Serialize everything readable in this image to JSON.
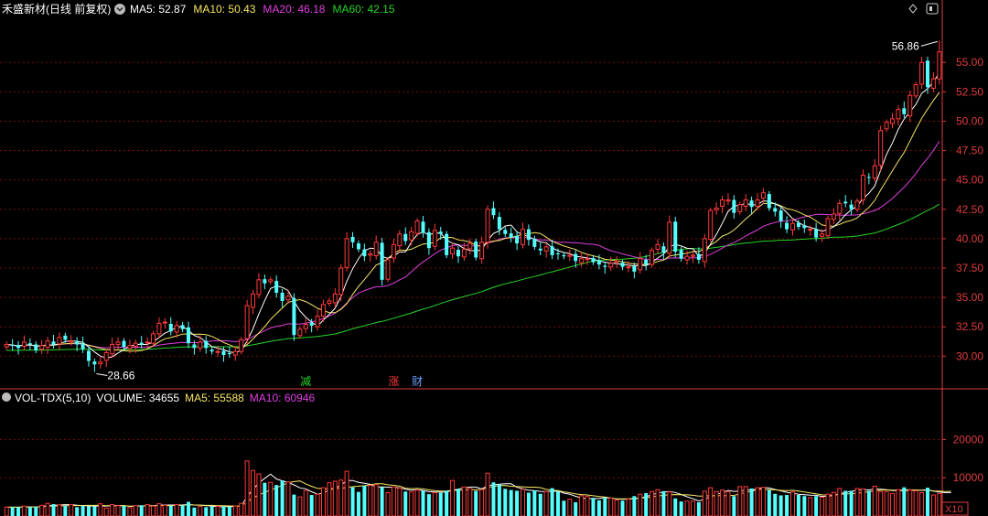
{
  "header": {
    "stock_name": "禾盛新材(日线 前复权)",
    "ma_labels": [
      {
        "text": "MA5: 52.87",
        "color": "#ffffff"
      },
      {
        "text": "MA10: 50.43",
        "color": "#f5e663"
      },
      {
        "text": "MA20: 46.18",
        "color": "#e040e0"
      },
      {
        "text": "MA60: 42.15",
        "color": "#27d427"
      }
    ]
  },
  "volume_header": {
    "labels": [
      {
        "text": "VOL-TDX(5,10)",
        "color": "#ffffff"
      },
      {
        "text": "VOLUME: 34655",
        "color": "#ffffff"
      },
      {
        "text": "MA5: 55588",
        "color": "#f5e663"
      },
      {
        "text": "MA10: 60946",
        "color": "#e040e0"
      }
    ]
  },
  "annotations": {
    "high_label": "56.86",
    "low_label": "28.66",
    "markers": [
      {
        "text": "减",
        "color": "#27d427",
        "index": 51
      },
      {
        "text": "涨",
        "color": "#ff3a3a",
        "index": 66
      },
      {
        "text": "财",
        "color": "#6aa0ff",
        "index": 70
      }
    ],
    "volume_unit": "X10"
  },
  "colors": {
    "up": "#ff3a3a",
    "down": "#54ffff",
    "grid": "#7a0e0e",
    "axis_text": "#e03c3c",
    "ma5": "#ffffff",
    "ma10": "#f5e663",
    "ma20": "#e040e0",
    "ma60": "#27d427"
  },
  "chart_data": {
    "type": "candlestick",
    "price_axis": {
      "ticks": [
        30.0,
        32.5,
        35.0,
        37.5,
        40.0,
        42.5,
        45.0,
        47.5,
        50.0,
        52.5,
        55.0
      ],
      "ylim": [
        27.3,
        58.6
      ]
    },
    "volume_axis": {
      "ticks": [
        10000,
        20000
      ],
      "ylim": [
        0,
        28000
      ]
    },
    "close": [
      31.0,
      30.9,
      30.7,
      31.2,
      31.0,
      30.5,
      30.9,
      31.3,
      31.0,
      31.6,
      31.4,
      31.3,
      31.0,
      30.6,
      29.6,
      29.3,
      29.5,
      30.3,
      31.0,
      31.2,
      30.8,
      30.9,
      31.1,
      31.0,
      31.2,
      31.9,
      32.8,
      32.9,
      32.1,
      32.6,
      32.3,
      31.1,
      30.7,
      31.2,
      30.7,
      30.4,
      30.4,
      30.1,
      30.2,
      30.4,
      31.4,
      34.3,
      35.3,
      36.5,
      36.2,
      36.5,
      35.4,
      34.7,
      35.1,
      31.8,
      32.3,
      32.7,
      32.6,
      33.4,
      34.4,
      34.7,
      35.3,
      37.5,
      40.0,
      39.7,
      39.1,
      38.5,
      38.7,
      39.7,
      36.5,
      38.2,
      39.5,
      40.4,
      39.8,
      40.6,
      41.5,
      40.5,
      39.2,
      40.7,
      40.4,
      38.6,
      39.2,
      38.5,
      39.1,
      39.6,
      38.4,
      39.7,
      42.5,
      42.0,
      40.8,
      40.4,
      40.1,
      39.6,
      40.8,
      39.9,
      39.3,
      39.0,
      39.3,
      38.6,
      38.7,
      38.5,
      38.6,
      38.1,
      38.3,
      38.3,
      38.0,
      37.8,
      37.6,
      37.9,
      38.1,
      37.6,
      37.6,
      37.2,
      38.3,
      37.8,
      39.0,
      39.5,
      38.8,
      41.4,
      38.9,
      38.3,
      38.5,
      38.6,
      38.2,
      40.0,
      42.4,
      42.6,
      43.3,
      43.3,
      42.2,
      42.9,
      43.3,
      42.7,
      43.3,
      43.9,
      42.6,
      42.3,
      41.5,
      40.8,
      41.3,
      41.0,
      40.9,
      40.8,
      40.1,
      40.4,
      41.7,
      42.1,
      43.0,
      43.0,
      42.5,
      43.2,
      45.4,
      45.2,
      46.2,
      49.2,
      49.9,
      50.2,
      51.0,
      50.6,
      52.2,
      53.1,
      55.0,
      52.9,
      53.6,
      55.9
    ],
    "volume": [
      2300,
      2300,
      2300,
      2600,
      2300,
      2400,
      2800,
      3300,
      3100,
      2900,
      2700,
      3000,
      2300,
      2700,
      2500,
      2500,
      3200,
      2100,
      3000,
      2700,
      2600,
      2200,
      2700,
      2800,
      3000,
      2600,
      3200,
      2800,
      2700,
      3000,
      2800,
      3700,
      2200,
      2500,
      2300,
      2500,
      2500,
      2500,
      2400,
      2600,
      3300,
      14400,
      11900,
      11000,
      8700,
      8800,
      8100,
      9300,
      8900,
      5600,
      5000,
      6700,
      5500,
      5700,
      7400,
      8700,
      9100,
      9400,
      11700,
      7500,
      6300,
      7900,
      8000,
      8200,
      7500,
      6100,
      7600,
      7300,
      6400,
      6300,
      6800,
      6600,
      5700,
      6100,
      6100,
      6600,
      9300,
      7100,
      7600,
      7200,
      6600,
      6900,
      11200,
      8800,
      8200,
      7100,
      6800,
      6600,
      7000,
      6100,
      6700,
      5800,
      6400,
      7300,
      6400,
      4000,
      4400,
      3600,
      5300,
      5100,
      4700,
      4100,
      4800,
      4700,
      4200,
      4000,
      4400,
      5200,
      5700,
      6000,
      6400,
      6900,
      6500,
      6300,
      4600,
      3800,
      3900,
      3900,
      3600,
      6500,
      7400,
      6400,
      6800,
      6400,
      5200,
      7700,
      7700,
      7200,
      7400,
      7500,
      6800,
      5800,
      5400,
      5500,
      6300,
      5500,
      5200,
      4800,
      5200,
      4900,
      5700,
      6200,
      7200,
      6600,
      6600,
      7200,
      7100,
      6600,
      7800,
      6400,
      6400,
      5900,
      6900,
      7500,
      6800,
      6600,
      6100,
      7400,
      5500,
      5900,
      5600,
      6200
    ]
  }
}
